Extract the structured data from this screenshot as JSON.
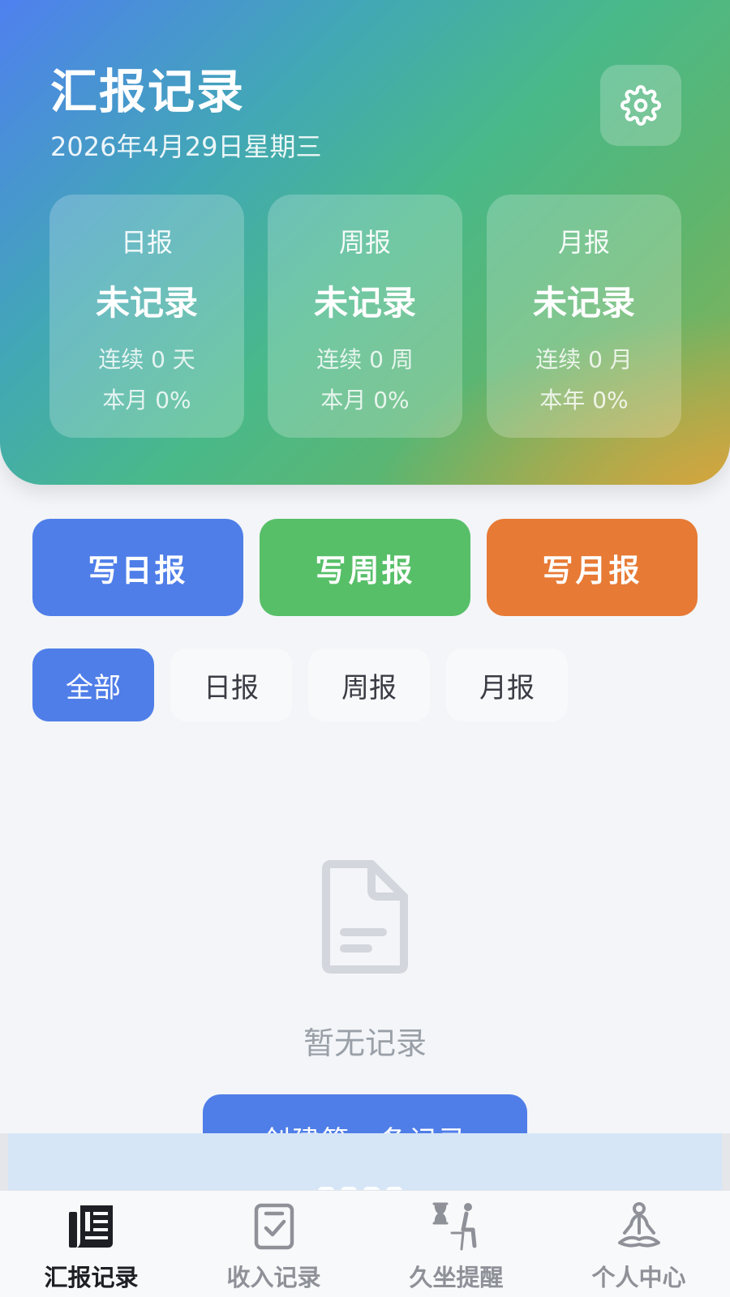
{
  "header": {
    "title": "汇报记录",
    "date": "2026年4月29日星期三",
    "settings_icon": "gear-icon"
  },
  "stats": [
    {
      "label": "日报",
      "status": "未记录",
      "streak": "连续 0 天",
      "rate": "本月 0%"
    },
    {
      "label": "周报",
      "status": "未记录",
      "streak": "连续 0 周",
      "rate": "本月 0%"
    },
    {
      "label": "月报",
      "status": "未记录",
      "streak": "连续 0 月",
      "rate": "本年 0%"
    }
  ],
  "write_buttons": [
    {
      "label": "写日报",
      "color": "#4f7ee8"
    },
    {
      "label": "写周报",
      "color": "#57bf68"
    },
    {
      "label": "写月报",
      "color": "#e77a35"
    }
  ],
  "filters": {
    "selected": "全部",
    "items": [
      "全部",
      "日报",
      "周报",
      "月报"
    ]
  },
  "empty_state": {
    "icon": "document-icon",
    "text": "暂无记录",
    "create_label": "创建第一条记录"
  },
  "tabbar": {
    "items": [
      {
        "label": "汇报记录",
        "icon": "newspaper-icon",
        "active": true
      },
      {
        "label": "收入记录",
        "icon": "checklist-icon",
        "active": false
      },
      {
        "label": "久坐提醒",
        "icon": "sitting-hourglass-icon",
        "active": false
      },
      {
        "label": "个人中心",
        "icon": "meditation-icon",
        "active": false
      }
    ]
  }
}
